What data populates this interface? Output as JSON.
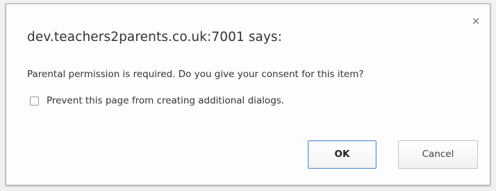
{
  "dialog": {
    "title": "dev.teachers2parents.co.uk:7001 says:",
    "message": "Parental permission is required. Do you give your consent for this item?",
    "close_icon": "close-icon",
    "close_glyph": "×",
    "checkbox": {
      "label": "Prevent this page from creating additional dialogs.",
      "checked": false
    },
    "buttons": {
      "ok_label": "OK",
      "cancel_label": "Cancel"
    }
  }
}
